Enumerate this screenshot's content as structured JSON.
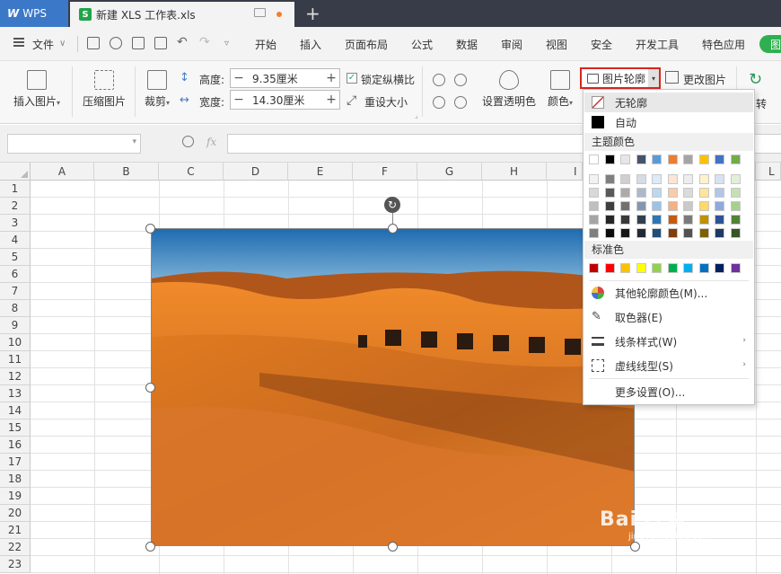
{
  "titlebar": {
    "app_tab": "WPS",
    "doc_tab": "新建 XLS 工作表.xls",
    "new_tab": "+"
  },
  "menubar": {
    "file": "文件",
    "tabs": [
      "开始",
      "插入",
      "页面布局",
      "公式",
      "数据",
      "审阅",
      "视图",
      "安全",
      "开发工具",
      "特色应用",
      "图"
    ]
  },
  "ribbon": {
    "insert_picture": "插入图片",
    "compress_picture": "压缩图片",
    "crop": "裁剪",
    "height_label": "高度:",
    "height_value": "9.35厘米",
    "width_label": "宽度:",
    "width_value": "14.30厘米",
    "lock_ratio": "锁定纵横比",
    "reset_size": "重设大小",
    "set_transparent": "设置透明色",
    "color": "颜色",
    "picture_outline": "图片轮廓",
    "change_picture": "更改图片",
    "rotate": "转"
  },
  "formulabar": {
    "fx": "fx"
  },
  "grid": {
    "columns": [
      "A",
      "B",
      "C",
      "D",
      "E",
      "F",
      "G",
      "H",
      "I",
      "L"
    ],
    "rows": [
      "1",
      "2",
      "3",
      "4",
      "5",
      "6",
      "7",
      "8",
      "9",
      "10",
      "11",
      "12",
      "13",
      "14",
      "15",
      "16",
      "17",
      "18",
      "19",
      "20",
      "21",
      "22",
      "23"
    ]
  },
  "dropdown": {
    "no_outline": "无轮廓",
    "auto": "自动",
    "theme_colors": "主题颜色",
    "standard_colors": "标准色",
    "more_colors": "其他轮廓颜色(M)...",
    "eyedropper": "取色器(E)",
    "line_style": "线条样式(W)",
    "dash_type": "虚线线型(S)",
    "more_settings": "更多设置(O)...",
    "theme_top_row": [
      "#ffffff",
      "#000000",
      "#e7e6e6",
      "#44546a",
      "#5b9bd5",
      "#ed7d31",
      "#a5a5a5",
      "#ffc000",
      "#4472c4",
      "#70ad47"
    ],
    "theme_shade_rows": [
      [
        "#f2f2f2",
        "#7f7f7f",
        "#d0cece",
        "#d6dce4",
        "#deebf6",
        "#fbe5d5",
        "#ededed",
        "#fff2cc",
        "#d9e2f3",
        "#e2efd9"
      ],
      [
        "#d8d8d8",
        "#595959",
        "#aeaaaa",
        "#adb9ca",
        "#bdd7ee",
        "#f7cbac",
        "#dbdbdb",
        "#fee599",
        "#b4c6e7",
        "#c5e0b3"
      ],
      [
        "#bfbfbf",
        "#3f3f3f",
        "#757070",
        "#8496b0",
        "#9cc3e5",
        "#f4b183",
        "#c9c9c9",
        "#ffd965",
        "#8eaadb",
        "#a8d08d"
      ],
      [
        "#a5a5a5",
        "#262626",
        "#3a3838",
        "#323f4f",
        "#2e75b5",
        "#c55a11",
        "#7b7b7b",
        "#bf9000",
        "#2f5496",
        "#538135"
      ],
      [
        "#7f7f7f",
        "#0c0c0c",
        "#171616",
        "#222a35",
        "#1e4e79",
        "#833c0b",
        "#525252",
        "#7f6000",
        "#1f3864",
        "#375623"
      ]
    ],
    "standard": [
      "#c00000",
      "#ff0000",
      "#ffc000",
      "#ffff00",
      "#92d050",
      "#00b050",
      "#00b0f0",
      "#0070c0",
      "#002060",
      "#7030a0"
    ]
  },
  "watermark": {
    "text": "Bai 经验",
    "url": "jingyan.baidu.com"
  }
}
